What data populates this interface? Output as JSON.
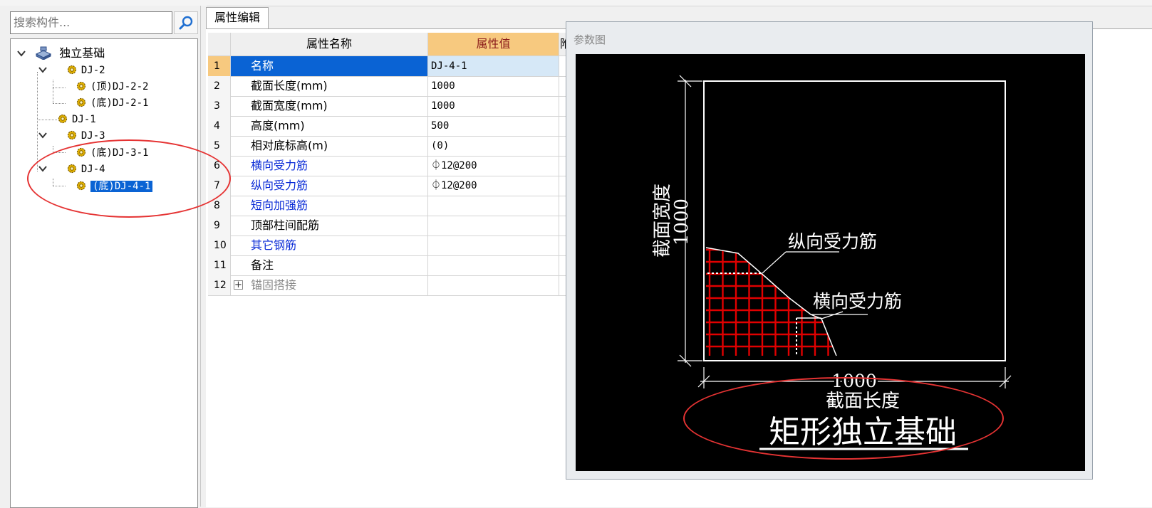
{
  "search": {
    "placeholder": "搜索构件..."
  },
  "tree": {
    "root": "独立基础",
    "nodes": [
      {
        "label": "DJ-2"
      },
      {
        "label": "(顶)DJ-2-2"
      },
      {
        "label": "(底)DJ-2-1"
      },
      {
        "label": "DJ-1"
      },
      {
        "label": "DJ-3"
      },
      {
        "label": "(底)DJ-3-1"
      },
      {
        "label": "DJ-4"
      },
      {
        "label": "(底)DJ-4-1",
        "selected": true
      }
    ]
  },
  "property_editor": {
    "tab_label": "属性编辑",
    "columns": {
      "name": "属性名称",
      "value": "属性值"
    },
    "rows": [
      {
        "num": "1",
        "name": "名称",
        "value": "DJ-4-1"
      },
      {
        "num": "2",
        "name": "截面长度(mm)",
        "value": "1000"
      },
      {
        "num": "3",
        "name": "截面宽度(mm)",
        "value": "1000"
      },
      {
        "num": "4",
        "name": "高度(mm)",
        "value": "500"
      },
      {
        "num": "5",
        "name": "相对底标高(m)",
        "value": "(0)"
      },
      {
        "num": "6",
        "name": "横向受力筋",
        "value": "⏀12@200"
      },
      {
        "num": "7",
        "name": "纵向受力筋",
        "value": "⏀12@200"
      },
      {
        "num": "8",
        "name": "短向加强筋",
        "value": ""
      },
      {
        "num": "9",
        "name": "顶部柱间配筋",
        "value": ""
      },
      {
        "num": "10",
        "name": "其它钢筋",
        "value": ""
      },
      {
        "num": "11",
        "name": "备注",
        "value": ""
      },
      {
        "num": "12",
        "name": "锚固搭接",
        "value": "",
        "expand": "+"
      }
    ],
    "header_extra": "附"
  },
  "parameter_diagram": {
    "title": "参数图",
    "width_label": "截面宽度",
    "width_value": "1000",
    "length_label": "截面长度",
    "length_value": "1000",
    "longitudinal_label": "纵向受力筋",
    "transverse_label": "横向受力筋",
    "caption": "矩形独立基础"
  },
  "colors": {
    "selection": "#0a63d4",
    "header_value_bg": "#f7c97f",
    "rebar": "#e00000",
    "annotation": "#e53333",
    "link_text": "#0a2bd6"
  },
  "icons": [
    "search-icon",
    "chevron-down-icon",
    "foundation-icon",
    "gear-icon",
    "expand-plus-icon"
  ]
}
